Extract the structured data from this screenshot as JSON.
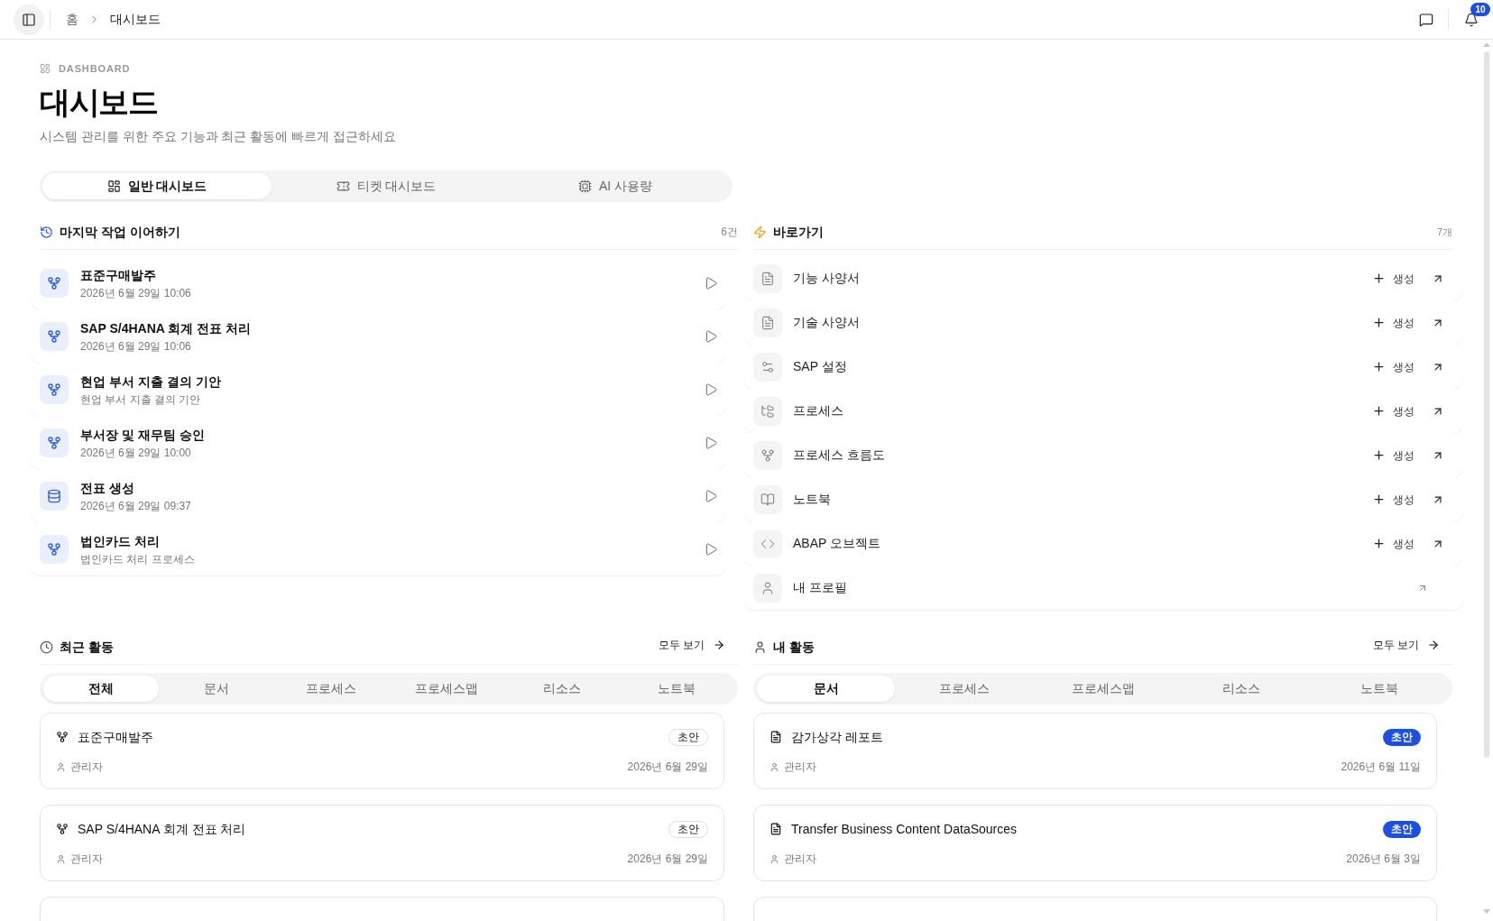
{
  "topbar": {
    "breadcrumb": [
      "홈",
      "대시보드"
    ],
    "notification_count": "10"
  },
  "header": {
    "eyebrow": "DASHBOARD",
    "title": "대시보드",
    "subtitle": "시스템 관리를 위한 주요 기능과 최근 활동에 빠르게 접근하세요"
  },
  "dashboard_tabs": [
    {
      "label": "일반 대시보드",
      "kind": "general",
      "selected": true
    },
    {
      "label": "티켓 대시보드",
      "kind": "ticket",
      "selected": false
    },
    {
      "label": "AI 사용량",
      "kind": "ai",
      "selected": false
    }
  ],
  "continue_work": {
    "title": "마지막 작업 이어하기",
    "count": "6건",
    "items": [
      {
        "kind": "process_flow",
        "title": "표준구매발주",
        "subtitle": "2026년 6월 29일 10:06"
      },
      {
        "kind": "process_flow",
        "title": "SAP S/4HANA 회계 전표 처리",
        "subtitle": "2026년 6월 29일 10:06"
      },
      {
        "kind": "process_flow",
        "title": "현업 부서 지출 결의 기안",
        "subtitle": "현업 부서 지출 결의 기안"
      },
      {
        "kind": "process_flow",
        "title": "부서장 및 재무팀 승인",
        "subtitle": "2026년 6월 29일 10:00"
      },
      {
        "kind": "table",
        "title": "전표 생성",
        "subtitle": "2026년 6월 29일 09:37"
      },
      {
        "kind": "process_flow",
        "title": "법인카드 처리",
        "subtitle": "법인카드 처리 프로세스"
      }
    ]
  },
  "shortcuts": {
    "title": "바로가기",
    "count": "7개",
    "items": [
      {
        "kind": "functional_spec",
        "label": "기능 사양서",
        "create_label": "생성"
      },
      {
        "kind": "technical_spec",
        "label": "기술 사양서",
        "create_label": "생성"
      },
      {
        "kind": "sap_config",
        "label": "SAP 설정",
        "create_label": "생성"
      },
      {
        "kind": "process",
        "label": "프로세스",
        "create_label": "생성"
      },
      {
        "kind": "process_flow",
        "label": "프로세스 흐름도",
        "create_label": "생성"
      },
      {
        "kind": "notebook",
        "label": "노트북",
        "create_label": "생성"
      },
      {
        "kind": "abap_object",
        "label": "ABAP 오브젝트",
        "create_label": "생성"
      },
      {
        "kind": "profile",
        "label": "내 프로필"
      }
    ]
  },
  "recent_activity": {
    "title": "최근 활동",
    "view_all": "모두 보기",
    "tabs": [
      {
        "label": "전체",
        "selected": true
      },
      {
        "label": "문서",
        "selected": false
      },
      {
        "label": "프로세스",
        "selected": false
      },
      {
        "label": "프로세스맵",
        "selected": false
      },
      {
        "label": "리소스",
        "selected": false
      },
      {
        "label": "노트북",
        "selected": false
      }
    ],
    "cards": [
      {
        "kind": "process_flow",
        "title": "표준구매발주",
        "badge": {
          "label": "초안",
          "kind": "outline"
        },
        "author": "관리자",
        "date": "2026년 6월 29일"
      },
      {
        "kind": "process_flow",
        "title": "SAP S/4HANA 회계 전표 처리",
        "badge": {
          "label": "초안",
          "kind": "outline"
        },
        "author": "관리자",
        "date": "2026년 6월 29일"
      }
    ]
  },
  "my_activity": {
    "title": "내 활동",
    "view_all": "모두 보기",
    "tabs": [
      {
        "label": "문서",
        "selected": true
      },
      {
        "label": "프로세스",
        "selected": false
      },
      {
        "label": "프로세스맵",
        "selected": false
      },
      {
        "label": "리소스",
        "selected": false
      },
      {
        "label": "노트북",
        "selected": false
      }
    ],
    "cards": [
      {
        "kind": "document",
        "title": "감가상각 레포트",
        "badge": {
          "label": "초안",
          "kind": "solid"
        },
        "author": "관리자",
        "date": "2026년 6월 11일"
      },
      {
        "kind": "document",
        "title": "Transfer Business Content DataSources",
        "badge": {
          "label": "초안",
          "kind": "solid"
        },
        "author": "관리자",
        "date": "2026년 6월 3일"
      }
    ]
  }
}
